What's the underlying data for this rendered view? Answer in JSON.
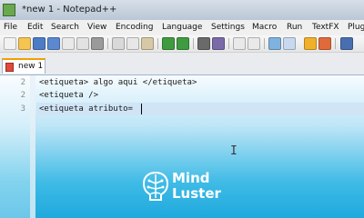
{
  "window": {
    "title": "*new 1 - Notepad++"
  },
  "menu": [
    "File",
    "Edit",
    "Search",
    "View",
    "Encoding",
    "Language",
    "Settings",
    "Macro",
    "Run",
    "TextFX",
    "Plug"
  ],
  "toolbar": {
    "icons": [
      "new-file-icon",
      "open-file-icon",
      "save-icon",
      "save-all-icon",
      "close-icon",
      "close-all-icon",
      "print-icon",
      "cut-icon",
      "copy-icon",
      "paste-icon",
      "undo-icon",
      "redo-icon",
      "find-icon",
      "replace-icon",
      "zoom-in-icon",
      "zoom-out-icon",
      "sync-scroll-icon",
      "word-wrap-icon",
      "show-all-chars-icon",
      "indent-guide-icon"
    ]
  },
  "tab": {
    "label": "new 1"
  },
  "editor": {
    "lines": [
      {
        "number": "2",
        "text": "<etiqueta> algo aqui </etiqueta>"
      },
      {
        "number": "2",
        "text": "<etiqueta />"
      },
      {
        "number": "3",
        "text": "<etiqueta atributo="
      }
    ]
  },
  "watermark": {
    "line1": "Mind",
    "line2": "Luster"
  },
  "colors": {
    "accent_tab": "#f0a000",
    "editor_gradient_bottom": "#1fa9dd",
    "current_line": "#d0e4f5"
  }
}
